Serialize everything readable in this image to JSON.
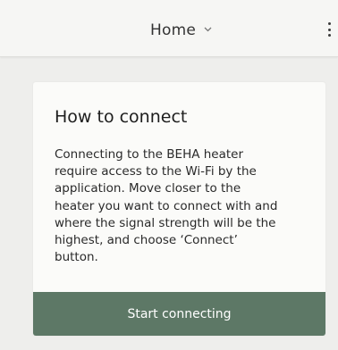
{
  "app_bar": {
    "location_label": "Home",
    "icons": {
      "location_dropdown": "chevron-down-icon",
      "menu": "more-vertical-icon"
    }
  },
  "card": {
    "title": "How to connect",
    "body": "Connecting to the BEHA heater require access to the Wi-Fi by the application. Move closer to the heater you want to connect with and where the signal strength will be the highest, and choose ‘Connect’ button.",
    "button_label": "Start connecting"
  },
  "colors": {
    "background": "#eeeeec",
    "app_bar": "#f6f6f4",
    "card": "#fbfbf9",
    "button": "#5d7866",
    "button_text": "#ffffff"
  }
}
